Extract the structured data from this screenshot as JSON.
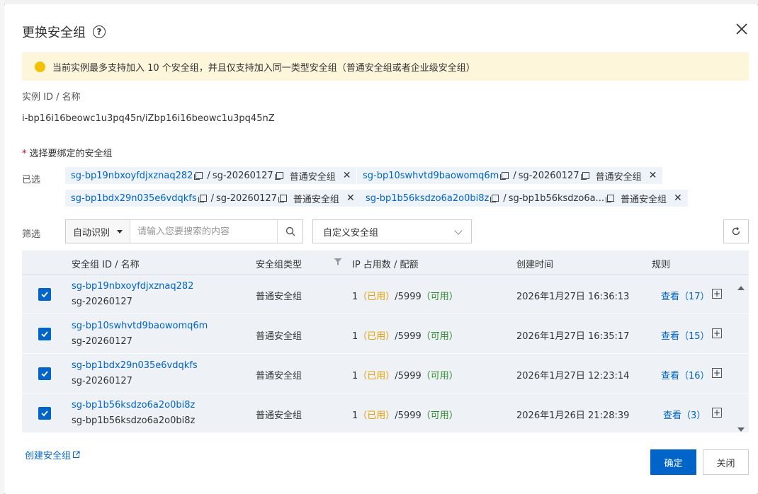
{
  "dialog": {
    "title": "更换安全组",
    "notice": "当前实例最多支持加入 10 个安全组，并且仅支持加入同一类型安全组（普通安全组或者企业级安全组）"
  },
  "instance": {
    "label": "实例 ID / 名称",
    "value": "i-bp16i16beowc1u3pq45n/iZbp16i16beowc1u3pq45nZ"
  },
  "selection": {
    "label": "选择要绑定的安全组",
    "selected_label": "已选",
    "chips": [
      {
        "id": "sg-bp19nbxoyfdjxznaq282",
        "name": "sg-20260127",
        "type": "普通安全组"
      },
      {
        "id": "sg-bp10swhvtd9baowomq6m",
        "name": "sg-20260127",
        "type": "普通安全组"
      },
      {
        "id": "sg-bp1bdx29n035e6vdqkfs",
        "name": "sg-20260127",
        "type": "普通安全组"
      },
      {
        "id": "sg-bp1b56ksdzo6a2o0bi8z",
        "name": "sg-bp1b56ksdzo6a...",
        "type": "普通安全组"
      }
    ]
  },
  "filter": {
    "label": "筛选",
    "mode": "自动识别",
    "placeholder": "请输入您要搜索的内容",
    "group": "自定义安全组"
  },
  "table": {
    "headers": {
      "id_name": "安全组 ID / 名称",
      "type": "安全组类型",
      "ip": "IP 占用数 / 配额",
      "created": "创建时间",
      "rules": "规则"
    },
    "ip_used_label": "（已用）",
    "ip_avail_label": "（可用）",
    "view_label": "查看",
    "rows": [
      {
        "id": "sg-bp19nbxoyfdjxznaq282",
        "name": "sg-20260127",
        "type": "普通安全组",
        "ip_used": "1",
        "ip_quota": "/5999",
        "created": "2026年1月27日 16:36:13",
        "rule_count": "（17）",
        "checked": true
      },
      {
        "id": "sg-bp10swhvtd9baowomq6m",
        "name": "sg-20260127",
        "type": "普通安全组",
        "ip_used": "1",
        "ip_quota": "/5999",
        "created": "2026年1月27日 16:35:17",
        "rule_count": "（15）",
        "checked": true
      },
      {
        "id": "sg-bp1bdx29n035e6vdqkfs",
        "name": "sg-20260127",
        "type": "普通安全组",
        "ip_used": "1",
        "ip_quota": "/5999",
        "created": "2026年1月27日 12:23:14",
        "rule_count": "（16）",
        "checked": true
      },
      {
        "id": "sg-bp1b56ksdzo6a2o0bi8z",
        "name": "sg-bp1b56ksdzo6a2o0bi8z",
        "type": "普通安全组",
        "ip_used": "1",
        "ip_quota": "/5999",
        "created": "2026年1月26日 21:28:39",
        "rule_count": "（3）",
        "checked": true
      }
    ]
  },
  "footer": {
    "create_link": "创建安全组",
    "confirm": "确定",
    "close": "关闭"
  },
  "colors": {
    "primary": "#0064c8",
    "notice_bg": "#fdf6db",
    "used": "#e5a200",
    "available": "#2e8b2e"
  }
}
